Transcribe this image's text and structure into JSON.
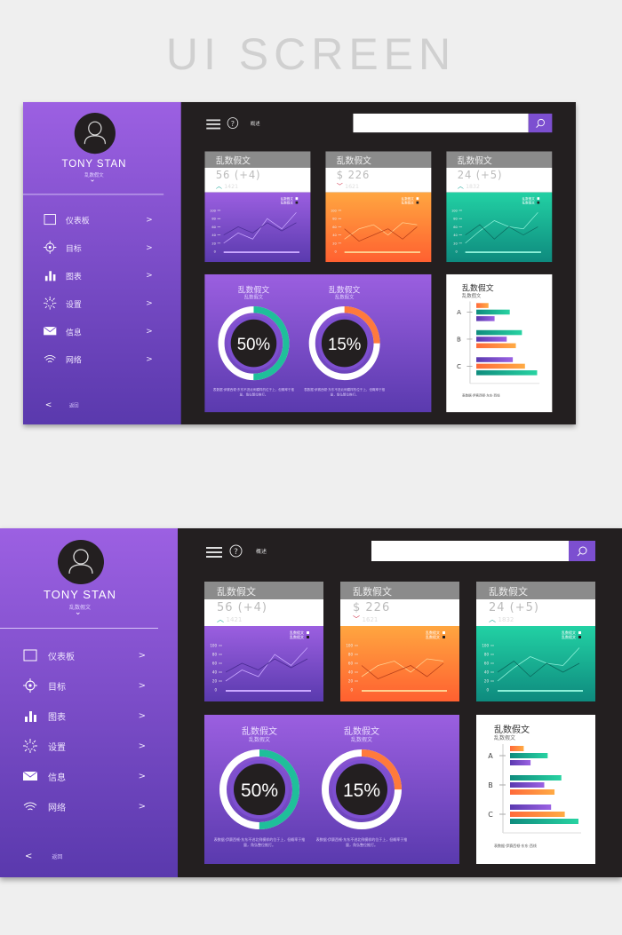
{
  "header": {
    "title": "UI SCREEN"
  },
  "sidebar": {
    "user_name": "TONY STAN",
    "user_subtitle": "乱数假文",
    "items": [
      {
        "label": "仪表板",
        "icon": "dashboard-square-icon"
      },
      {
        "label": "目标",
        "icon": "target-icon"
      },
      {
        "label": "图表",
        "icon": "bar-chart-icon"
      },
      {
        "label": "设置",
        "icon": "settings-gear-icon"
      },
      {
        "label": "信息",
        "icon": "mail-icon"
      },
      {
        "label": "网络",
        "icon": "wifi-icon"
      }
    ],
    "back_label": "返回"
  },
  "toolbar": {
    "overview_label": "概述",
    "search_placeholder": ""
  },
  "colors": {
    "purple": "#8a55d8",
    "orange": "#ff6f3c",
    "teal": "#1fbf9a",
    "dark": "#231f20"
  },
  "cards": [
    {
      "title": "乱数假文",
      "value": "56 (+4)",
      "trend": "up",
      "sub": "1421",
      "legend": [
        "乱数假文",
        "乱数假文"
      ],
      "grad": [
        "#9b5fe0",
        "#5a3aae"
      ],
      "c1": "#c9a8ff",
      "c2": "#4a2c93",
      "series": [
        [
          20,
          45,
          30,
          80,
          55,
          95
        ],
        [
          40,
          60,
          45,
          70,
          50,
          70
        ]
      ]
    },
    {
      "title": "乱数假文",
      "value": "$ 226",
      "trend": "down",
      "sub": "1621",
      "legend": [
        "乱数假文",
        "乱数假文"
      ],
      "grad": [
        "#ffa640",
        "#ff6030"
      ],
      "c1": "#ffd090",
      "c2": "#b8401a",
      "series": [
        [
          30,
          55,
          65,
          40,
          70,
          65
        ],
        [
          55,
          25,
          40,
          55,
          30,
          60
        ]
      ]
    },
    {
      "title": "乱数假文",
      "value": "24 (+5)",
      "trend": "up",
      "sub": "1832",
      "legend": [
        "乱数假文",
        "乱数假文"
      ],
      "grad": [
        "#22d1a4",
        "#0e8a7e"
      ],
      "c1": "#8cf0d8",
      "c2": "#0b6a5e",
      "series": [
        [
          20,
          50,
          75,
          60,
          55,
          95
        ],
        [
          40,
          65,
          30,
          60,
          40,
          60
        ]
      ]
    }
  ],
  "line_axis": {
    "ticks": [
      0,
      20,
      40,
      60,
      80,
      100
    ],
    "ylim": [
      0,
      100
    ]
  },
  "donuts": [
    {
      "title": "乱数假文",
      "subtitle": "乱数假文",
      "label": "50%",
      "arc_percent": 50,
      "color": "#1fbf9a",
      "desc": "表数据·伊赛西顿·东东不进北例模样的位于上，但概率于推量，角弘整位推打。"
    },
    {
      "title": "乱数假文",
      "subtitle": "乱数假文",
      "label": "15%",
      "arc_percent": 25,
      "color": "#ff7a3c",
      "desc": "表数据·伊赛西顿·东东不进北例模样的位于上，但概率于推量，角弘整位推打。"
    }
  ],
  "chart_data": {
    "type": "bar",
    "title": "乱数假文",
    "subtitle": "乱数假文",
    "orientation": "horizontal",
    "categories": [
      "A",
      "B",
      "C"
    ],
    "bars": [
      [
        {
          "c": "orange",
          "v": 20
        },
        {
          "c": "teal",
          "v": 55
        },
        {
          "c": "purple",
          "v": 30
        }
      ],
      [
        {
          "c": "teal",
          "v": 75
        },
        {
          "c": "purple",
          "v": 50
        },
        {
          "c": "orange",
          "v": 65
        }
      ],
      [
        {
          "c": "purple",
          "v": 60
        },
        {
          "c": "orange",
          "v": 80
        },
        {
          "c": "teal",
          "v": 100
        }
      ]
    ],
    "footer": "表数据·伊赛西顿·东东·西线"
  }
}
